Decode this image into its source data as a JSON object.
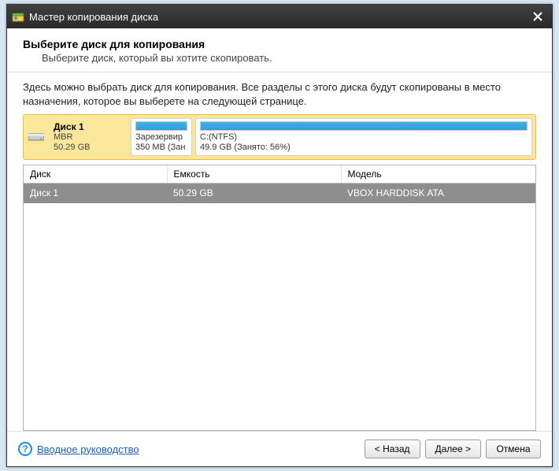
{
  "titlebar": {
    "title": "Мастер копирования диска"
  },
  "header": {
    "heading": "Выберите диск для копирования",
    "sub": "Выберите диск, который вы хотите скопировать."
  },
  "intro": "Здесь можно выбрать диск для копирования. Все разделы с этого диска будут скопированы в место назначения, которое вы выберете на следующей странице.",
  "disk_card": {
    "name": "Диск 1",
    "type": "MBR",
    "size": "50.29 GB",
    "partitions": [
      {
        "label1": "Зарезервир",
        "label2": "350 MB (Зан",
        "fill_pct": 100
      },
      {
        "label1": "C:(NTFS)",
        "label2": "49.9 GB (Занято: 56%)",
        "fill_pct": 100
      }
    ]
  },
  "table": {
    "headers": {
      "disk": "Диск",
      "capacity": "Емкость",
      "model": "Модель"
    },
    "rows": [
      {
        "disk": "Диск 1",
        "capacity": "50.29 GB",
        "model": "VBOX HARDDISK ATA"
      }
    ]
  },
  "footer": {
    "help_link": "Вводное руководство",
    "back": "< Назад",
    "next": "Далее >",
    "cancel": "Отмена"
  }
}
